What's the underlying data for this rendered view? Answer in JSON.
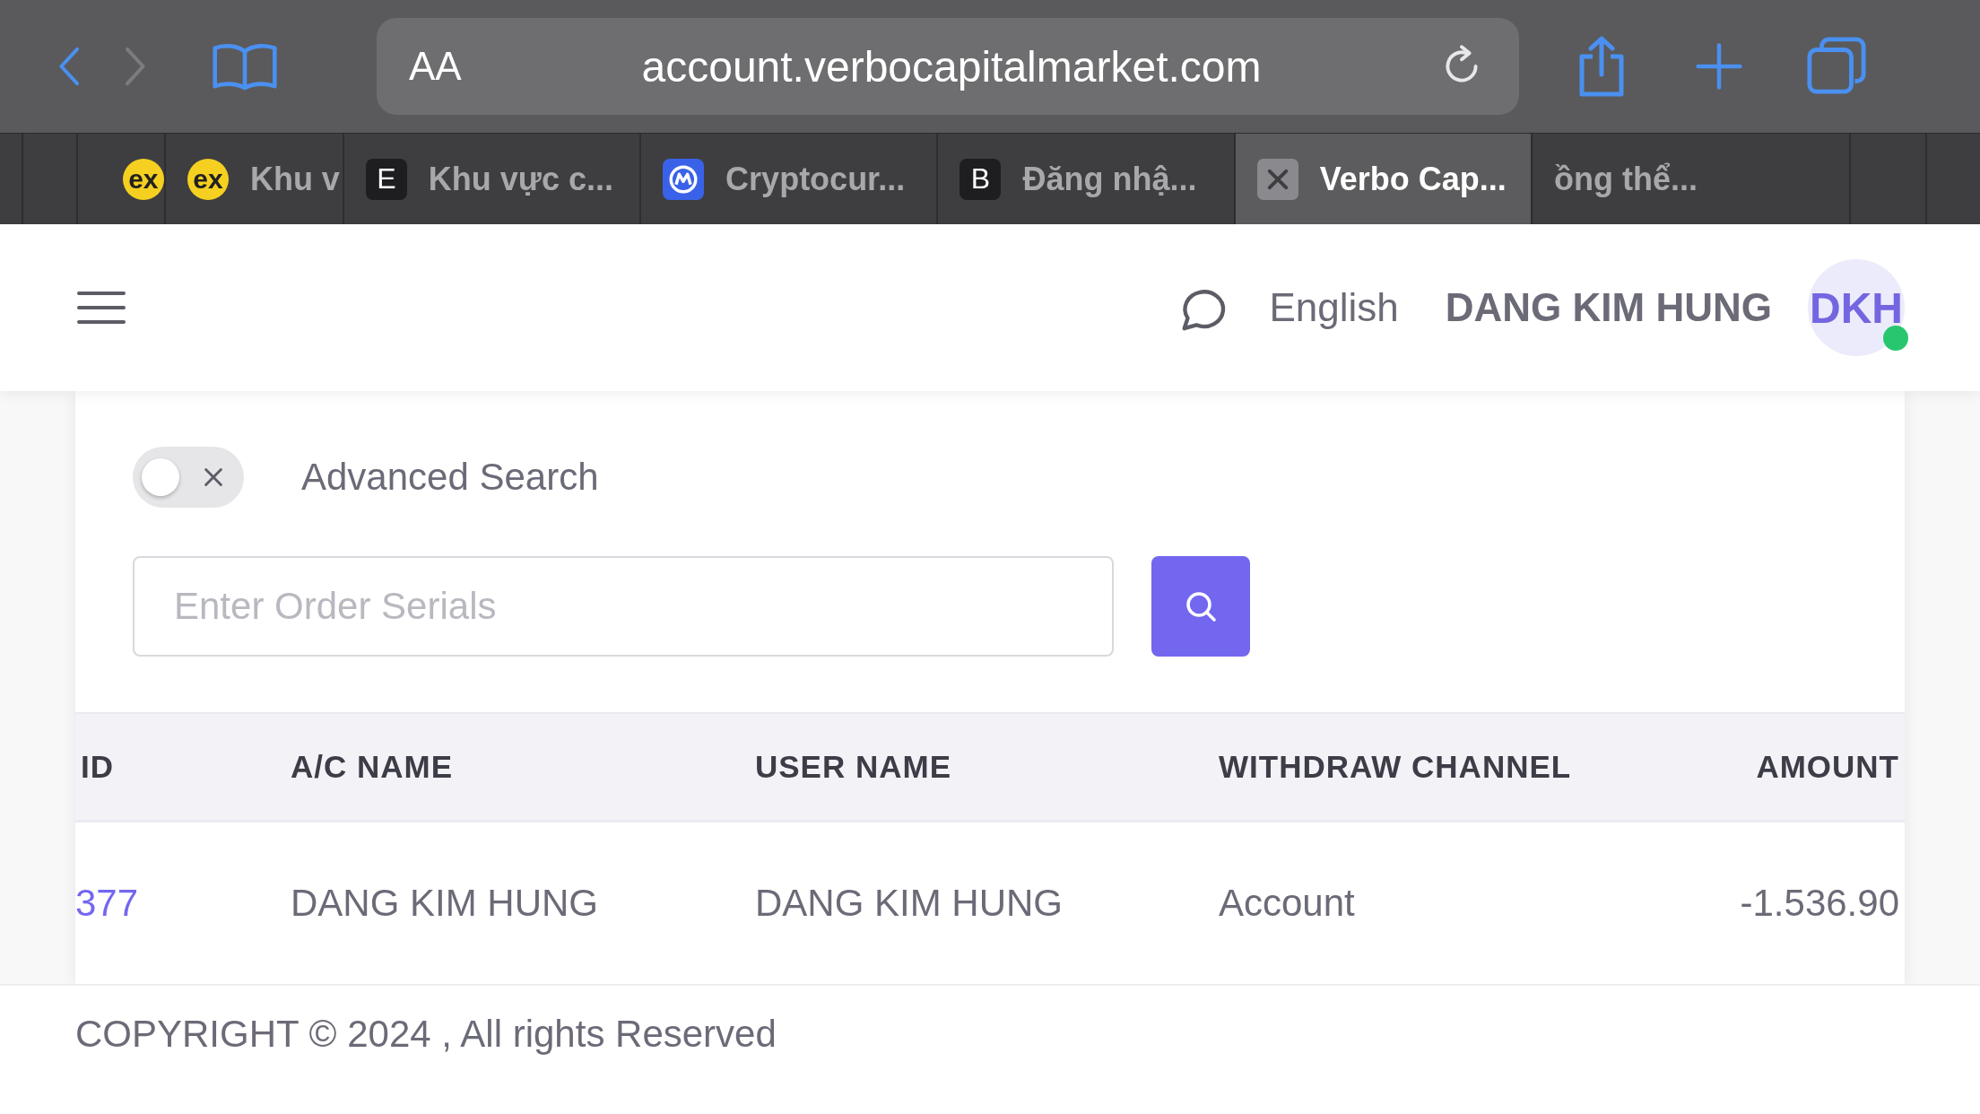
{
  "browser": {
    "back": {
      "disabled": false
    },
    "forward": {
      "disabled": true
    },
    "text_size_label": "AA",
    "url": "account.verbocapitalmarket.com"
  },
  "tabs": [
    {
      "kind": "ex",
      "icon_text": "ex",
      "selected": false
    },
    {
      "kind": "ex",
      "icon_text": "ex",
      "label": "Khu v",
      "selected": false
    },
    {
      "kind": "letter",
      "icon_text": "E",
      "label": "Khu vực c...",
      "selected": false
    },
    {
      "kind": "coin",
      "label": "Cryptocur...",
      "selected": false
    },
    {
      "kind": "letter",
      "icon_text": "B",
      "label": "Đăng nhậ...",
      "selected": false
    },
    {
      "kind": "close",
      "label": "Verbo Cap...",
      "selected": true
    },
    {
      "kind": "plain",
      "label": "ồng thể...",
      "selected": false
    }
  ],
  "header": {
    "language": "English",
    "user_name": "DANG KIM HUNG",
    "avatar_initials": "DKH",
    "online": true
  },
  "search": {
    "advanced_search": {
      "label": "Advanced Search",
      "on": false
    },
    "placeholder": "Enter Order Serials"
  },
  "table": {
    "columns": [
      "ID",
      "A/C NAME",
      "USER NAME",
      "WITHDRAW CHANNEL",
      "AMOUNT"
    ],
    "rows": [
      {
        "cells": [
          "377",
          "DANG KIM HUNG",
          "DANG KIM HUNG",
          "Account",
          "-1.536.90"
        ]
      }
    ]
  },
  "footer": "COPYRIGHT © 2024 , All rights Reserved"
}
